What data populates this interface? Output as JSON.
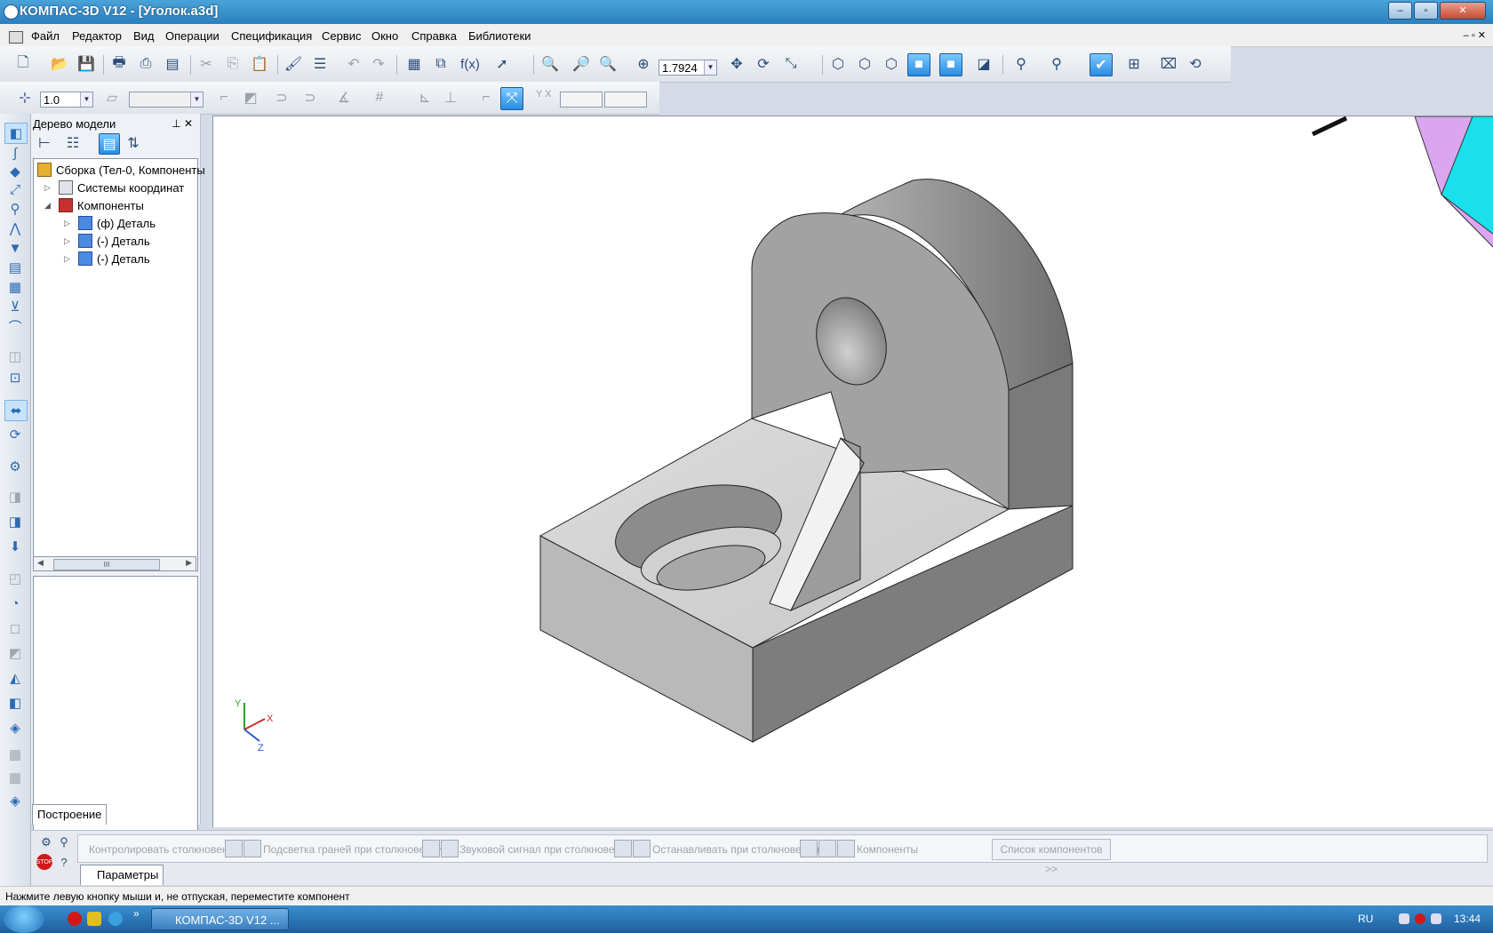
{
  "window": {
    "title": "КОМПАС-3D V12 - [Уголок.a3d]",
    "minimize_label": "–",
    "maximize_label": "▫",
    "close_label": "✕"
  },
  "menu": {
    "items": [
      "Файл",
      "Редактор",
      "Вид",
      "Операции",
      "Спецификация",
      "Сервис",
      "Окно",
      "Справка",
      "Библиотеки"
    ],
    "mdi_controls": "– ▫ ✕"
  },
  "toolbar": {
    "zoom_value": "1.7924",
    "step_value": "1.0",
    "fx_label": "f(x)",
    "coord_label": "Y X"
  },
  "model_tree": {
    "header": "Дерево модели",
    "header_buttons": "⊥ ✕",
    "nodes": [
      {
        "label": "Сборка (Тел-0, Компоненты",
        "icon": "assembly-icon"
      },
      {
        "label": "Системы координат",
        "icon": "coordinate-systems-icon"
      },
      {
        "label": "Компоненты",
        "icon": "components-icon"
      },
      {
        "label": "(ф) Деталь",
        "icon": "part-icon"
      },
      {
        "label": "(-) Деталь",
        "icon": "part-icon"
      },
      {
        "label": "(-) Деталь",
        "icon": "part-icon"
      }
    ],
    "tab_label": "Построение",
    "scroll_thumb": "III"
  },
  "properties_panel": {
    "items": [
      "Контролировать столкновения",
      "Подсветка граней при столкновении",
      "Звуковой сигнал при столкновении",
      "Останавливать при столкновении",
      "Компоненты"
    ],
    "list_button": "Список компонентов  >>",
    "tab_label": "Параметры"
  },
  "triad": {
    "x": "X",
    "y": "Y",
    "z": "Z"
  },
  "status": {
    "text": "Нажмите левую кнопку мыши и, не отпуская, переместите компонент"
  },
  "taskbar": {
    "task_label": "КОМПАС-3D V12 ...",
    "language": "RU",
    "clock": "13:44",
    "overflow": "»"
  },
  "colors": {
    "part_top": "#d4d4d4",
    "part_side_light": "#b4b4b4",
    "part_side_dark": "#7a7a7a",
    "accent": "#2a7fbf"
  }
}
